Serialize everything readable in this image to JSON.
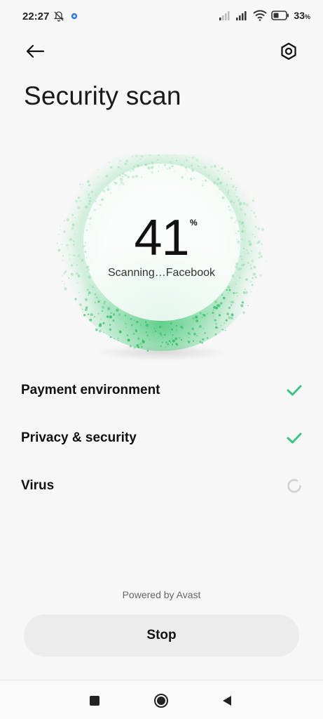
{
  "status": {
    "time": "22:27",
    "battery": "33",
    "battery_unit": "%"
  },
  "header": {
    "title": "Security scan"
  },
  "scan": {
    "percent": "41",
    "percent_sign": "%",
    "status_text": "Scanning…Facebook",
    "progress": 0.41,
    "accent_color": "#3ecf7a"
  },
  "checks": [
    {
      "label": "Payment environment",
      "state": "done"
    },
    {
      "label": "Privacy & security",
      "state": "done"
    },
    {
      "label": "Virus",
      "state": "in-progress"
    }
  ],
  "colors": {
    "check": "#3cc488",
    "spinner": "#bdbdbd"
  },
  "footer": {
    "powered_by": "Powered by Avast",
    "stop_label": "Stop"
  }
}
